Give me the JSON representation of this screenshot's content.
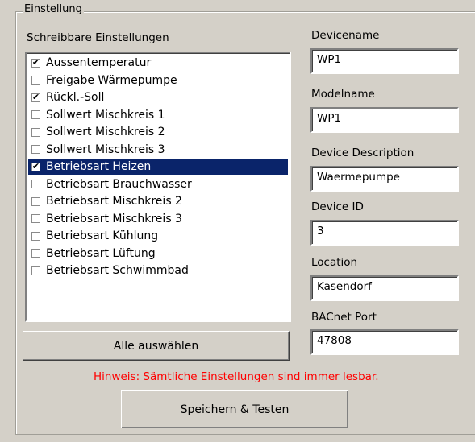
{
  "group": {
    "title": "Einstellung"
  },
  "writable": {
    "label": "Schreibbare Einstellungen",
    "items": [
      {
        "label": "Aussentemperatur",
        "checked": true
      },
      {
        "label": "Freigabe Wärmepumpe",
        "checked": false
      },
      {
        "label": "Rückl.-Soll",
        "checked": true
      },
      {
        "label": "Sollwert Mischkreis 1",
        "checked": false
      },
      {
        "label": "Sollwert Mischkreis 2",
        "checked": false
      },
      {
        "label": "Sollwert Mischkreis 3",
        "checked": false
      },
      {
        "label": "Betriebsart Heizen",
        "checked": true,
        "selected": true
      },
      {
        "label": "Betriebsart Brauchwasser",
        "checked": false
      },
      {
        "label": "Betriebsart Mischkreis 2",
        "checked": false
      },
      {
        "label": "Betriebsart Mischkreis 3",
        "checked": false
      },
      {
        "label": "Betriebsart Kühlung",
        "checked": false
      },
      {
        "label": "Betriebsart Lüftung",
        "checked": false
      },
      {
        "label": "Betriebsart Schwimmbad",
        "checked": false
      }
    ]
  },
  "fields": {
    "devicename": {
      "label": "Devicename",
      "value": "WP1"
    },
    "modelname": {
      "label": "Modelname",
      "value": "WP1"
    },
    "description": {
      "label": "Device Description",
      "value": "Waermepumpe"
    },
    "device_id": {
      "label": "Device ID",
      "value": "3"
    },
    "location": {
      "label": "Location",
      "value": "Kasendorf"
    },
    "bacnet_port": {
      "label": "BACnet Port",
      "value": "47808"
    }
  },
  "buttons": {
    "select_all": "Alle auswählen",
    "save_test": "Speichern & Testen"
  },
  "hint": "Hinweis: Sämtliche Einstellungen sind immer lesbar.",
  "colors": {
    "background": "#d4d0c8",
    "selection": "#0a246a",
    "hint": "#ff0000"
  }
}
